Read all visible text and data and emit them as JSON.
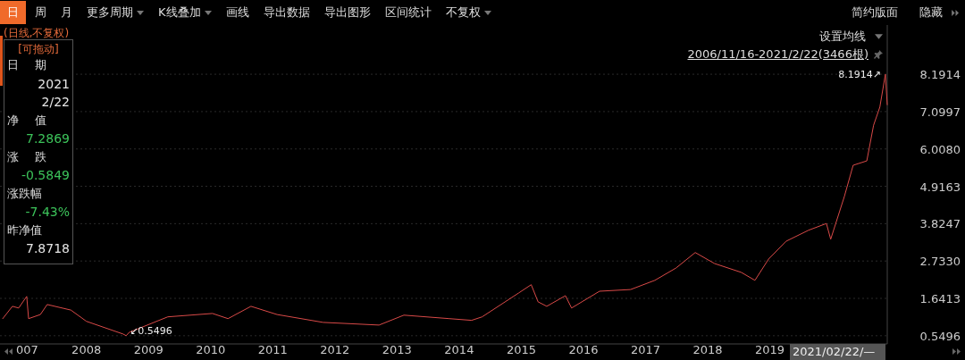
{
  "toolbar": {
    "items": [
      {
        "label": "日",
        "selected": true,
        "dropdown": false
      },
      {
        "label": "周",
        "selected": false,
        "dropdown": false
      },
      {
        "label": "月",
        "selected": false,
        "dropdown": false
      },
      {
        "label": "更多周期",
        "selected": false,
        "dropdown": true
      },
      {
        "label": "K线叠加",
        "selected": false,
        "dropdown": true
      },
      {
        "label": "画线",
        "selected": false,
        "dropdown": false
      },
      {
        "label": "导出数据",
        "selected": false,
        "dropdown": false
      },
      {
        "label": "导出图形",
        "selected": false,
        "dropdown": false
      },
      {
        "label": "区间统计",
        "selected": false,
        "dropdown": false
      },
      {
        "label": "不复权",
        "selected": false,
        "dropdown": true
      }
    ],
    "right_items": [
      "简约版面",
      "隐藏"
    ]
  },
  "mode_label": "(日线,不复权)",
  "info_panel": {
    "drag_hint": "[可拖动]",
    "fields": [
      {
        "label": "日 期",
        "lines": [
          "2021",
          "2/22"
        ],
        "color": "#e6e6e6"
      },
      {
        "label": "净 值",
        "lines": [
          "7.2869"
        ],
        "color": "#3cc35a"
      },
      {
        "label": "涨 跌",
        "lines": [
          "-0.5849"
        ],
        "color": "#3cc35a"
      },
      {
        "label": "涨跌幅",
        "lines": [
          "-7.43%"
        ],
        "color": "#3cc35a"
      },
      {
        "label": "昨净值",
        "lines": [
          "7.8718"
        ],
        "color": "#e6e6e6"
      }
    ]
  },
  "ma_setting": "设置均线",
  "range_link": "2006/11/16-2021/2/22(3466根)",
  "cursor_date": "2021/02/22/—",
  "x_axis_cut_label": "007",
  "chart_data": {
    "type": "line",
    "grid": true,
    "xlim": [
      2006.61,
      2020.89
    ],
    "ylim": [
      0.31,
      9.63
    ],
    "xticks": [
      2008,
      2009,
      2010,
      2011,
      2012,
      2013,
      2014,
      2015,
      2016,
      2017,
      2018,
      2019
    ],
    "yticks": [
      {
        "value": 8.1914,
        "label": "8.1914"
      },
      {
        "value": 7.0997,
        "label": "7.0997"
      },
      {
        "value": 6.008,
        "label": "6.0080"
      },
      {
        "value": 4.9163,
        "label": "4.9163"
      },
      {
        "value": 3.8247,
        "label": "3.8247"
      },
      {
        "value": 2.733,
        "label": "2.7330"
      },
      {
        "value": 1.6413,
        "label": "1.6413"
      },
      {
        "value": 0.5496,
        "label": "0.5496"
      }
    ],
    "x": [
      2006.65,
      2006.81,
      2006.91,
      2007.04,
      2007.07,
      2007.26,
      2007.37,
      2007.75,
      2008.0,
      2008.59,
      2008.64,
      2008.69,
      2009.31,
      2010.03,
      2010.28,
      2010.65,
      2011.07,
      2011.81,
      2012.71,
      2013.11,
      2013.84,
      2014.2,
      2014.37,
      2014.96,
      2015.16,
      2015.27,
      2015.41,
      2015.71,
      2015.81,
      2016.26,
      2016.76,
      2017.15,
      2017.49,
      2017.8,
      2018.11,
      2018.54,
      2018.76,
      2018.98,
      2019.26,
      2019.62,
      2019.91,
      2019.98,
      2020.2,
      2020.34,
      2020.56,
      2020.67,
      2020.77,
      2020.86,
      2020.89
    ],
    "series": [
      {
        "color": "#d94a48",
        "values": [
          1.04,
          1.41,
          1.36,
          1.7,
          1.05,
          1.17,
          1.46,
          1.3,
          0.97,
          0.6,
          0.55,
          0.65,
          1.1,
          1.2,
          1.05,
          1.41,
          1.17,
          0.94,
          0.86,
          1.15,
          1.05,
          1.0,
          1.1,
          1.8,
          2.04,
          1.54,
          1.41,
          1.72,
          1.36,
          1.85,
          1.9,
          2.17,
          2.53,
          2.98,
          2.66,
          2.4,
          2.17,
          2.79,
          3.31,
          3.63,
          3.83,
          3.37,
          4.62,
          5.53,
          5.66,
          6.7,
          7.23,
          8.19,
          7.29
        ]
      }
    ],
    "annotations": [
      {
        "x": 2020.86,
        "y": 8.19,
        "text": "8.1914↗"
      },
      {
        "x": 2008.64,
        "y": 0.55,
        "text": "↙0.5496"
      }
    ]
  }
}
